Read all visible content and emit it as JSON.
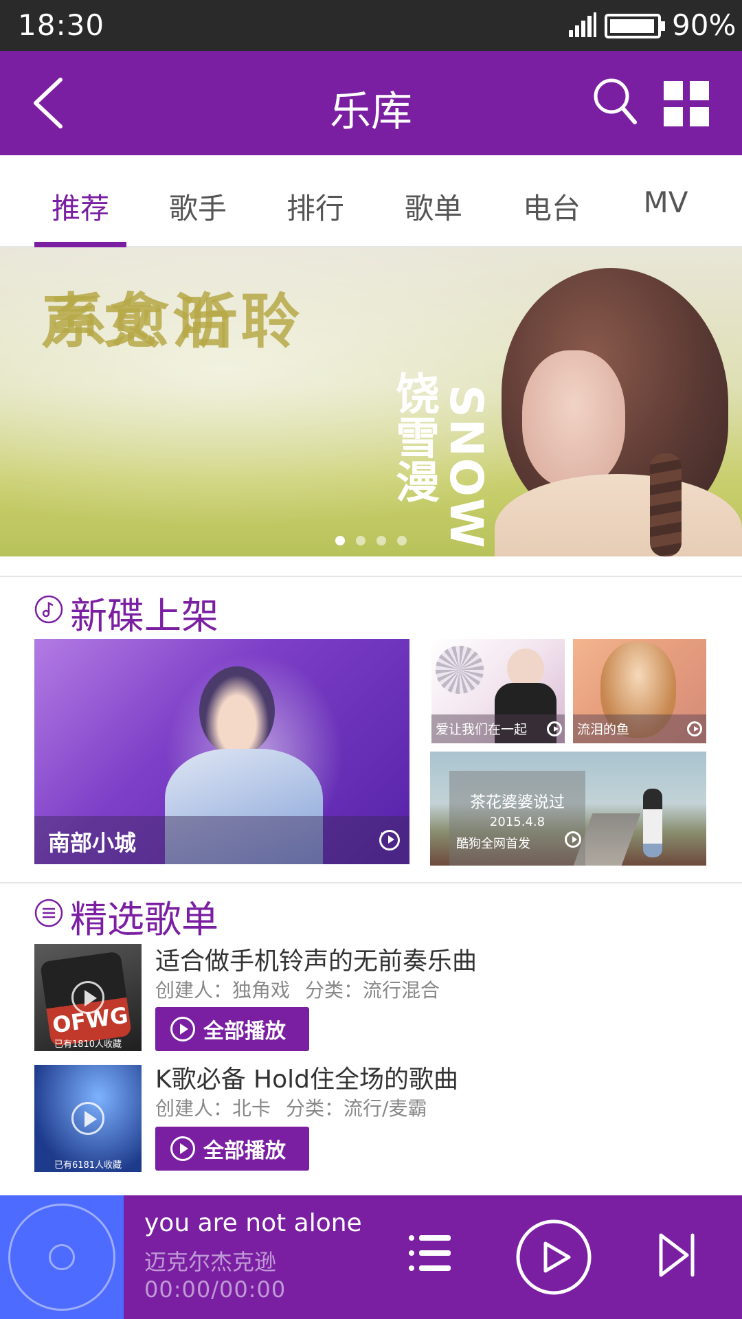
{
  "status_bar": {
    "time": "18:30",
    "battery": "90%"
  },
  "header": {
    "title": "乐库"
  },
  "tabs": [
    {
      "label": "推荐",
      "active": true
    },
    {
      "label": "歌手",
      "active": false
    },
    {
      "label": "排行",
      "active": false
    },
    {
      "label": "歌单",
      "active": false
    },
    {
      "label": "电台",
      "active": false
    },
    {
      "label": "MV",
      "active": false
    }
  ],
  "banner": {
    "columns": [
      "聆听",
      "治愈系",
      "女声"
    ],
    "artist_cn": "饶雪漫",
    "artist_en": "SNOW",
    "slide_count": 4,
    "active_slide": 1
  },
  "new_albums": {
    "heading": "新碟上架",
    "featured": {
      "title": "南部小城"
    },
    "small": [
      {
        "title": "爱让我们在一起"
      },
      {
        "title": "流泪的鱼"
      }
    ],
    "wide": {
      "title": "茶花婆婆说过",
      "date": "2015.4.8",
      "note": "酷狗全网首发"
    }
  },
  "playlists": {
    "heading": "精选歌单",
    "items": [
      {
        "title": "适合做手机铃声的无前奏乐曲",
        "creator_label": "创建人：",
        "creator": "独角戏",
        "category_label": "分类：",
        "category": "流行混合",
        "favorites": "已有1810人收藏",
        "cover_brand": "OFWG",
        "play_all": "全部播放"
      },
      {
        "title": "K歌必备 Hold住全场的歌曲",
        "creator_label": "创建人：",
        "creator": "北卡",
        "category_label": "分类：",
        "category": "流行/麦霸",
        "favorites": "已有6181人收藏",
        "play_all": "全部播放"
      }
    ]
  },
  "player": {
    "song": "you are not alone",
    "artist": "迈克尔杰克逊",
    "progress": "00:00/00:00"
  },
  "colors": {
    "brand_purple": "#7b1fa2",
    "disc_blue": "#4d6bff",
    "status_bar": "#2a2a2a"
  },
  "icons": {
    "header": [
      "back-arrow-icon",
      "search-icon",
      "grid-menu-icon"
    ],
    "section": [
      "music-note-icon",
      "list-icon"
    ],
    "player": [
      "disc-icon",
      "playlist-icon",
      "play-icon",
      "next-track-icon"
    ]
  }
}
